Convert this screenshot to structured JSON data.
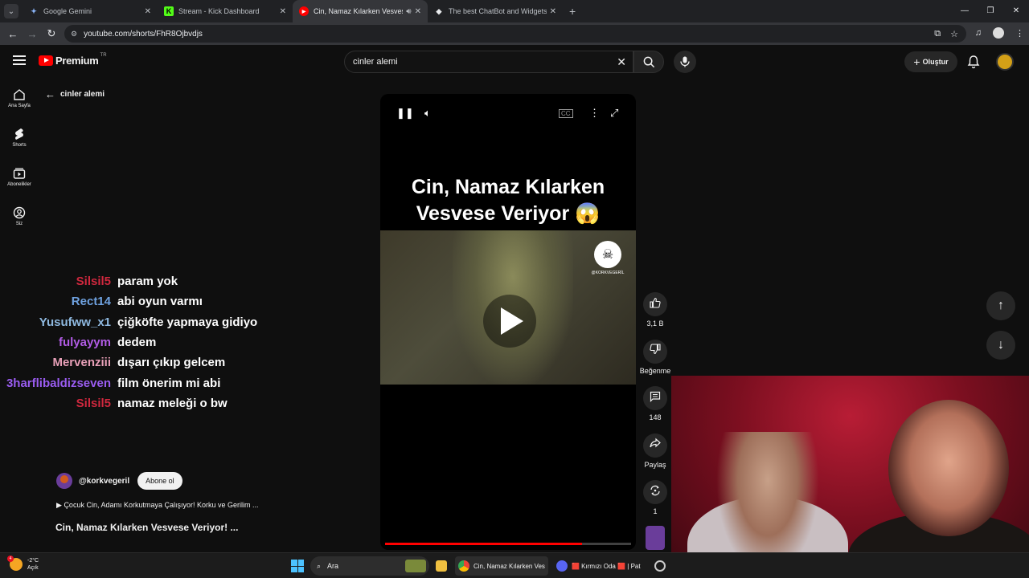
{
  "browser": {
    "tabs": [
      {
        "title": "Google Gemini",
        "icon": "gemini-icon",
        "active": false
      },
      {
        "title": "Stream - Kick Dashboard",
        "icon": "kick-icon",
        "active": false
      },
      {
        "title": "Cin, Namaz Kılarken Vesvese",
        "icon": "youtube-icon",
        "active": true
      },
      {
        "title": "The best ChatBot and Widgets",
        "icon": "chatbot-icon",
        "active": false
      }
    ],
    "url": "youtube.com/shorts/FhR8Ojbvdjs"
  },
  "youtube": {
    "logo_text": "Premium",
    "region": "TR",
    "search_query": "cinler alemi",
    "create_label": "Oluştur",
    "sidebar": [
      {
        "label": "Ana Sayfa",
        "icon": "home-icon"
      },
      {
        "label": "Shorts",
        "icon": "shorts-icon"
      },
      {
        "label": "Abonelikler",
        "icon": "subscriptions-icon"
      },
      {
        "label": "Siz",
        "icon": "you-icon"
      }
    ],
    "back_label": "cinler alemi",
    "channel_handle": "@korkvegeril",
    "subscribe_label": "Abone ol",
    "description": "Çocuk Cin, Adamı Korkutmaya Çalışıyor! Korku ve Gerilim ...",
    "video_title": "Cin, Namaz Kılarken Vesvese Veriyor!  ...",
    "overlay_line1": "Cin, Namaz Kılarken",
    "overlay_line2": "Vesvese Veriyor 😱",
    "watermark": "@KORKVEGERİL",
    "progress": 0.8,
    "actions": [
      {
        "label": "3,1 B",
        "icon": "like-icon"
      },
      {
        "label": "Beğenme",
        "icon": "dislike-icon"
      },
      {
        "label": "148",
        "icon": "comment-icon"
      },
      {
        "label": "Paylaş",
        "icon": "share-icon"
      },
      {
        "label": "1",
        "icon": "remix-icon"
      }
    ]
  },
  "chat": [
    {
      "user": "Silsil5",
      "color": "#d0283e",
      "message": "param yok"
    },
    {
      "user": "Rect14",
      "color": "#6fa2e0",
      "message": "abi oyun varmı"
    },
    {
      "user": "Yusufww_x1",
      "color": "#8fb9e0",
      "message": "çiğköfte yapmaya gidiyo"
    },
    {
      "user": "fulyayym",
      "color": "#b25ce6",
      "message": "dedem"
    },
    {
      "user": "Mervenziii",
      "color": "#e8a0b8",
      "message": "dışarı çıkıp gelcem"
    },
    {
      "user": "3harflibaldizseven",
      "color": "#9a5cf0",
      "message": "film önerim mi abi"
    },
    {
      "user": "Silsil5",
      "color": "#d0283e",
      "message": "namaz meleği o bw"
    }
  ],
  "taskbar": {
    "temp": "-2°C",
    "condition": "Açık",
    "weather_badge": "4",
    "search_label": "Ara",
    "chrome_label": "Cin, Namaz Kılarken Ves",
    "discord_label": "🟥 Kırmızı Oda 🟥 | Pat"
  }
}
